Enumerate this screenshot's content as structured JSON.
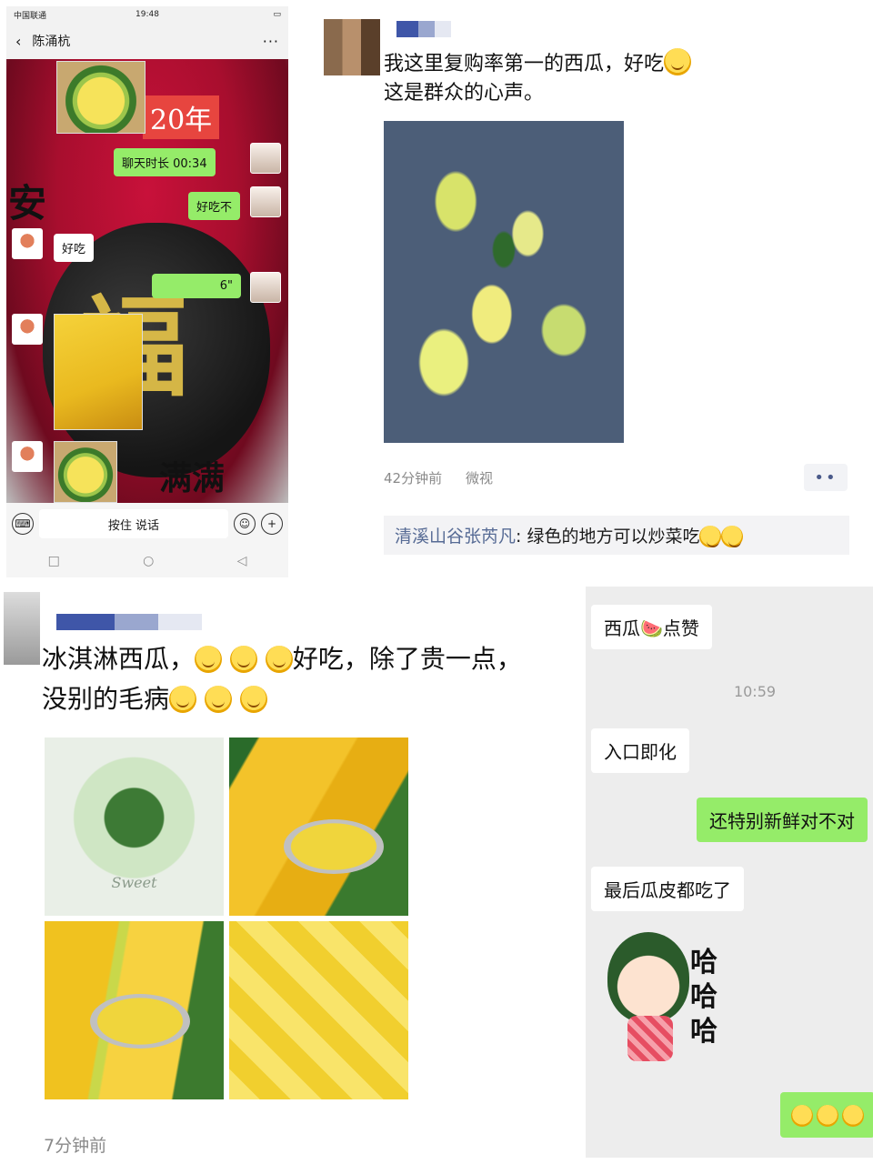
{
  "phone_chat": {
    "status": {
      "carrier": "中国联通",
      "time": "19:48"
    },
    "header": {
      "contact_name": "陈涌杭",
      "back_glyph": "‹",
      "more_glyph": "···"
    },
    "background_text": {
      "year": "20年",
      "left_char": "安",
      "bottom_text": "满满",
      "center_char": "福"
    },
    "messages": [
      {
        "from": "me",
        "text": "聊天时长 00:34"
      },
      {
        "from": "me",
        "text": "好吃不"
      },
      {
        "from": "them",
        "text": "好吃"
      },
      {
        "from": "me",
        "text": "6\""
      }
    ],
    "input_bar": {
      "hold_to_talk": "按住 说话"
    }
  },
  "moment_post_1": {
    "text_line_1": "我这里复购率第一的西瓜，好吃",
    "text_line_2": "这是群众的心声。",
    "time_ago": "42分钟前",
    "source": "微视",
    "more_glyph": "••",
    "comment": {
      "name": "清溪山谷张芮凡",
      "text": ": 绿色的地方可以炒菜吃"
    }
  },
  "moment_post_2": {
    "text_line_1": "冰淇淋西瓜，",
    "text_line_1b": "好吃，除了贵一点，",
    "text_line_2": "没别的毛病",
    "grid_caption": "Sweet",
    "time_ago": "7分钟前"
  },
  "chat_2": {
    "messages": [
      {
        "from": "them",
        "text": "西瓜🍉点赞"
      },
      {
        "from": "time",
        "text": "10:59"
      },
      {
        "from": "them",
        "text": "入口即化"
      },
      {
        "from": "me",
        "text": "还特别新鲜对不对"
      },
      {
        "from": "them",
        "text": "最后瓜皮都吃了"
      }
    ],
    "sticker_text": [
      "哈",
      "哈",
      "哈"
    ]
  },
  "colors": {
    "wechat_green": "#95ec69",
    "chat_bg": "#ededed",
    "link_blue": "#576b95"
  },
  "icons": {
    "voice": "voice-icon",
    "emoji": "emoji-icon",
    "plus": "plus-icon"
  }
}
